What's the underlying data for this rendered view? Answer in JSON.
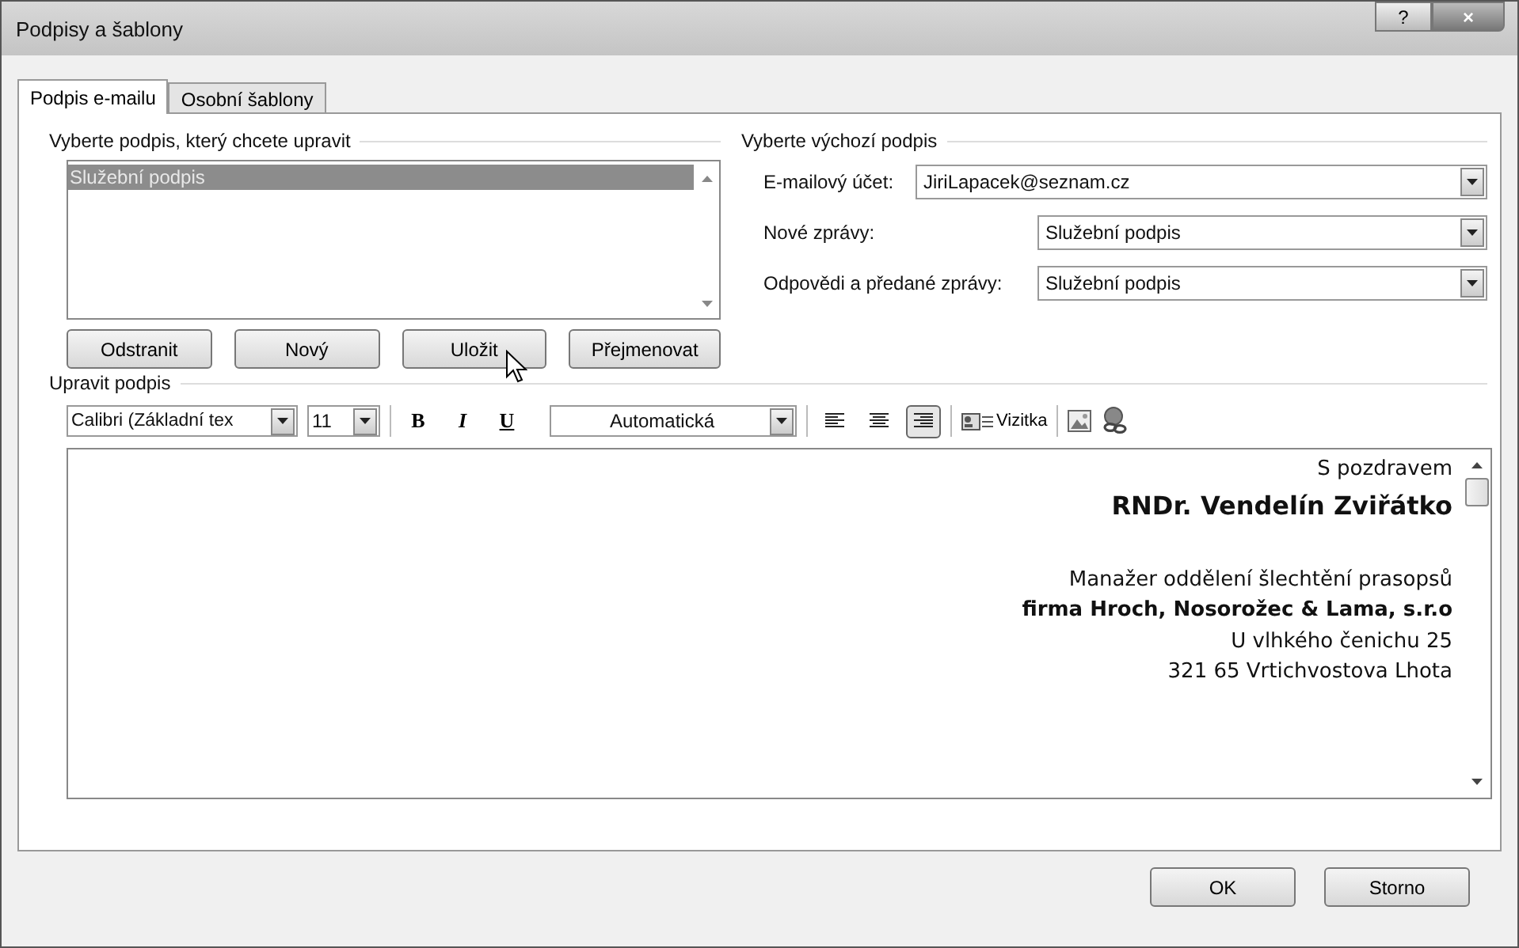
{
  "window": {
    "title": "Podpisy a šablony",
    "help": "?",
    "close": "×"
  },
  "tabs": [
    {
      "label": "Podpis e-mailu",
      "selected": true
    },
    {
      "label": "Osobní šablony",
      "selected": false
    }
  ],
  "signatures": {
    "heading": "Vyberte podpis, který chcete upravit",
    "items": [
      {
        "label": "Služební podpis",
        "selected": true
      }
    ],
    "buttons": [
      "Odstranit",
      "Nový",
      "Uložit",
      "Přejmenovat"
    ]
  },
  "defaults": {
    "heading": "Vyberte výchozí podpis",
    "fields": [
      {
        "label": "E-mailový účet:",
        "value": "JiriLapacek@seznam.cz",
        "kind": "wide"
      },
      {
        "label": "Nové zprávy:",
        "value": "Služební podpis",
        "kind": "narrow"
      },
      {
        "label": "Odpovědi a předané zprávy:",
        "value": "Služební podpis",
        "kind": "narrow"
      }
    ]
  },
  "editor": {
    "heading": "Upravit podpis",
    "font": "Calibri (Základní tex",
    "size": "11",
    "format": [
      {
        "label": "B",
        "kind": "bold"
      },
      {
        "label": "I",
        "kind": "italic"
      },
      {
        "label": "U",
        "kind": "underline"
      }
    ],
    "text_color": "Automatická",
    "align": [
      {
        "kind": "left",
        "selected": false
      },
      {
        "kind": "center",
        "selected": false
      },
      {
        "kind": "right",
        "selected": true
      }
    ],
    "card": "Vizitka",
    "lines": [
      {
        "text": "S pozdravem",
        "kind": "plain"
      },
      {
        "text": "RNDr. Vendelín Zviřátko",
        "kind": "title"
      },
      {
        "text": "Manažer oddělení šlechtění prasopsů",
        "kind": "plain"
      },
      {
        "text": "firma Hroch, Nosorožec & Lama, s.r.o",
        "kind": "bold"
      },
      {
        "text": "U vlhkého čenichu 25",
        "kind": "plain"
      },
      {
        "text": "321 65 Vrtichvostova Lhota",
        "kind": "plain"
      }
    ]
  },
  "buttons": [
    "OK",
    "Storno"
  ]
}
